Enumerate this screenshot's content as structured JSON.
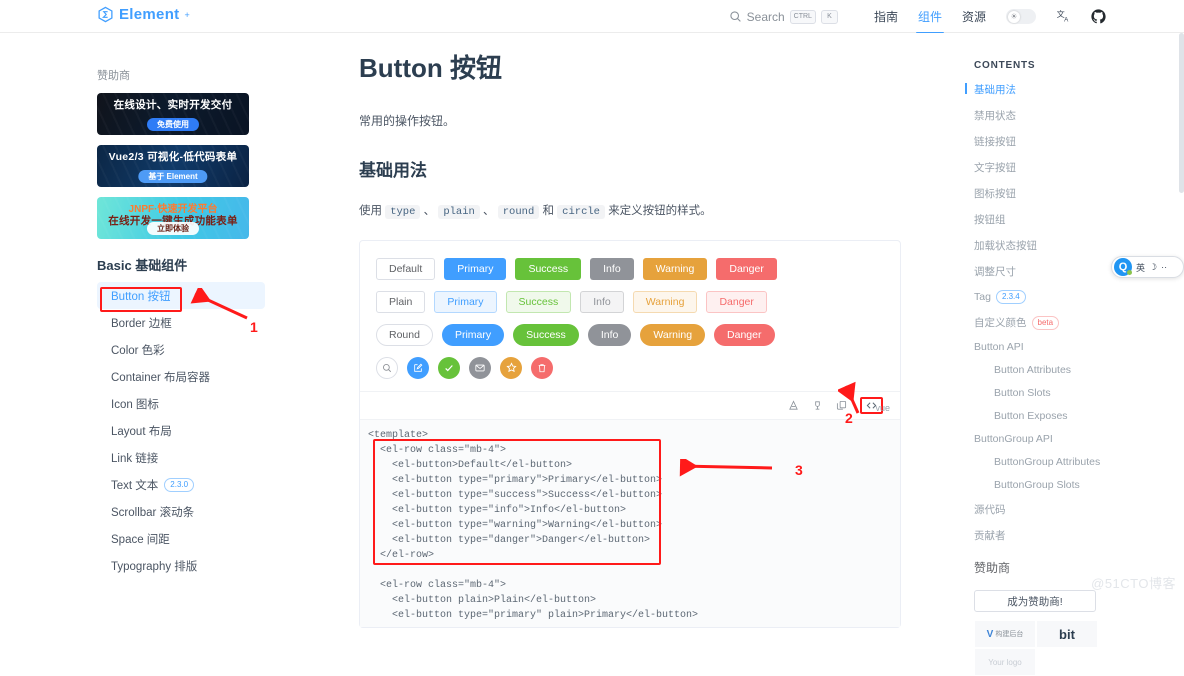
{
  "header": {
    "brand": "Element",
    "brand_sup": "+",
    "search": {
      "label": "Search",
      "kbd1": "CTRL",
      "kbd2": "K"
    },
    "nav": [
      {
        "label": "指南",
        "active": false
      },
      {
        "label": "组件",
        "active": true
      },
      {
        "label": "资源",
        "active": false
      }
    ],
    "theme_icon": "sun-icon",
    "lang_icon": "translate-icon",
    "github_icon": "github-icon"
  },
  "sidebar": {
    "sponsor_label": "赞助商",
    "banners": [
      {
        "title": "在线设计、实时开发交付",
        "cta": "免费使用"
      },
      {
        "title": "Vue2/3 可视化-低代码表单",
        "cta": "基于 Element"
      },
      {
        "brand": "JNPF·快速开发平台",
        "title": "在线开发一键生成功能表单",
        "cta": "立即体验"
      }
    ],
    "group_title": "Basic 基础组件",
    "items": [
      {
        "label": "Button 按钮",
        "active": true,
        "tag": ""
      },
      {
        "label": "Border 边框",
        "active": false,
        "tag": ""
      },
      {
        "label": "Color 色彩",
        "active": false,
        "tag": ""
      },
      {
        "label": "Container 布局容器",
        "active": false,
        "tag": ""
      },
      {
        "label": "Icon 图标",
        "active": false,
        "tag": ""
      },
      {
        "label": "Layout 布局",
        "active": false,
        "tag": ""
      },
      {
        "label": "Link 链接",
        "active": false,
        "tag": ""
      },
      {
        "label": "Text 文本",
        "active": false,
        "tag": "2.3.0"
      },
      {
        "label": "Scrollbar 滚动条",
        "active": false,
        "tag": ""
      },
      {
        "label": "Space 间距",
        "active": false,
        "tag": ""
      },
      {
        "label": "Typography 排版",
        "active": false,
        "tag": ""
      }
    ]
  },
  "main": {
    "title": "Button 按钮",
    "description": "常用的操作按钮。",
    "section_title": "基础用法",
    "para_prefix": "使用",
    "para_codes": [
      "type",
      "plain",
      "round",
      "circle"
    ],
    "para_sep1": "、",
    "para_sep2": "、",
    "para_and": "和",
    "para_suffix": "来定义按钮的样式。",
    "rows": [
      {
        "style": "solid",
        "buttons": [
          {
            "label": "Default",
            "type": "default"
          },
          {
            "label": "Primary",
            "type": "primary"
          },
          {
            "label": "Success",
            "type": "success"
          },
          {
            "label": "Info",
            "type": "info"
          },
          {
            "label": "Warning",
            "type": "warning"
          },
          {
            "label": "Danger",
            "type": "danger"
          }
        ]
      },
      {
        "style": "plain",
        "buttons": [
          {
            "label": "Plain",
            "type": "default"
          },
          {
            "label": "Primary",
            "type": "primary"
          },
          {
            "label": "Success",
            "type": "success"
          },
          {
            "label": "Info",
            "type": "info"
          },
          {
            "label": "Warning",
            "type": "warning"
          },
          {
            "label": "Danger",
            "type": "danger"
          }
        ]
      },
      {
        "style": "round",
        "buttons": [
          {
            "label": "Round",
            "type": "default"
          },
          {
            "label": "Primary",
            "type": "primary"
          },
          {
            "label": "Success",
            "type": "success"
          },
          {
            "label": "Info",
            "type": "info"
          },
          {
            "label": "Warning",
            "type": "warning"
          },
          {
            "label": "Danger",
            "type": "danger"
          }
        ]
      }
    ],
    "circle_buttons": [
      {
        "icon": "search-icon",
        "type": "default"
      },
      {
        "icon": "edit-icon",
        "type": "primary"
      },
      {
        "icon": "check-icon",
        "type": "success"
      },
      {
        "icon": "message-icon",
        "type": "info"
      },
      {
        "icon": "star-icon",
        "type": "warning"
      },
      {
        "icon": "delete-icon",
        "type": "danger"
      }
    ],
    "toolbar_icons": [
      "codepen-icon",
      "jsfiddle-icon",
      "copy-icon",
      "show-code-icon"
    ],
    "vue_tag": "vue",
    "code": "<template>\n  <el-row class=\"mb-4\">\n    <el-button>Default</el-button>\n    <el-button type=\"primary\">Primary</el-button>\n    <el-button type=\"success\">Success</el-button>\n    <el-button type=\"info\">Info</el-button>\n    <el-button type=\"warning\">Warning</el-button>\n    <el-button type=\"danger\">Danger</el-button>\n  </el-row>\n\n  <el-row class=\"mb-4\">\n    <el-button plain>Plain</el-button>\n    <el-button type=\"primary\" plain>Primary</el-button>"
  },
  "toc": {
    "title": "CONTENTS",
    "items": [
      {
        "label": "基础用法",
        "active": true,
        "level": 1,
        "tag": ""
      },
      {
        "label": "禁用状态",
        "active": false,
        "level": 1,
        "tag": ""
      },
      {
        "label": "链接按钮",
        "active": false,
        "level": 1,
        "tag": ""
      },
      {
        "label": "文字按钮",
        "active": false,
        "level": 1,
        "tag": ""
      },
      {
        "label": "图标按钮",
        "active": false,
        "level": 1,
        "tag": ""
      },
      {
        "label": "按钮组",
        "active": false,
        "level": 1,
        "tag": ""
      },
      {
        "label": "加载状态按钮",
        "active": false,
        "level": 1,
        "tag": ""
      },
      {
        "label": "调整尺寸",
        "active": false,
        "level": 1,
        "tag": ""
      },
      {
        "label": "Tag",
        "active": false,
        "level": 1,
        "tag": "2.3.4"
      },
      {
        "label": "自定义颜色",
        "active": false,
        "level": 1,
        "tag": "beta"
      },
      {
        "label": "Button API",
        "active": false,
        "level": 1,
        "tag": ""
      },
      {
        "label": "Button Attributes",
        "active": false,
        "level": 2,
        "tag": ""
      },
      {
        "label": "Button Slots",
        "active": false,
        "level": 2,
        "tag": ""
      },
      {
        "label": "Button Exposes",
        "active": false,
        "level": 2,
        "tag": ""
      },
      {
        "label": "ButtonGroup API",
        "active": false,
        "level": 1,
        "tag": ""
      },
      {
        "label": "ButtonGroup Attributes",
        "active": false,
        "level": 2,
        "tag": ""
      },
      {
        "label": "ButtonGroup Slots",
        "active": false,
        "level": 2,
        "tag": ""
      },
      {
        "label": "源代码",
        "active": false,
        "level": 1,
        "tag": ""
      },
      {
        "label": "贡献者",
        "active": false,
        "level": 1,
        "tag": ""
      }
    ],
    "sponsor_heading": "赞助商",
    "sponsor_button": "成为赞助商!",
    "logos": [
      {
        "name": "构建后台",
        "kind": "vue"
      },
      {
        "name": "bit",
        "kind": "text"
      },
      {
        "name": "Your logo",
        "kind": "placeholder"
      },
      {
        "name": "",
        "kind": "empty"
      }
    ]
  },
  "annotations": [
    {
      "number": "1"
    },
    {
      "number": "2"
    },
    {
      "number": "3"
    }
  ],
  "ime": {
    "logo": "Q",
    "mode": "英",
    "moon": "☽",
    "extra": "··"
  },
  "watermark": "@51CTO博客",
  "colors": {
    "primary": "#409eff",
    "success": "#67c23a",
    "info": "#909399",
    "warning": "#e6a23c",
    "danger": "#f56c6c",
    "annotation": "#ff1a1a"
  }
}
